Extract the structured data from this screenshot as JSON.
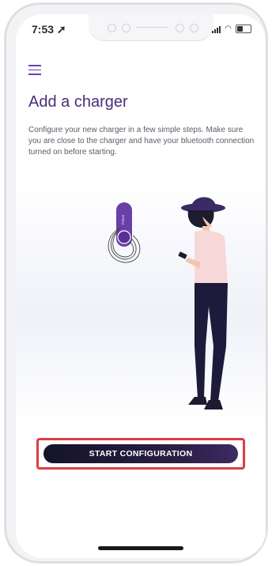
{
  "status_bar": {
    "time": "7:53"
  },
  "header": {
    "menu_icon": "hamburger-icon"
  },
  "page": {
    "title": "Add a charger",
    "description": "Configure your new charger in a few simple steps. Make sure you are close to the charger and have your bluetooth connection turned on before starting."
  },
  "illustration": {
    "charger_label": "Pulsar"
  },
  "actions": {
    "start_label": "START CONFIGURATION"
  },
  "colors": {
    "accent": "#6b3fa8",
    "title": "#4a2c7a",
    "button_dark": "#141428",
    "highlight_border": "#d93f45"
  }
}
